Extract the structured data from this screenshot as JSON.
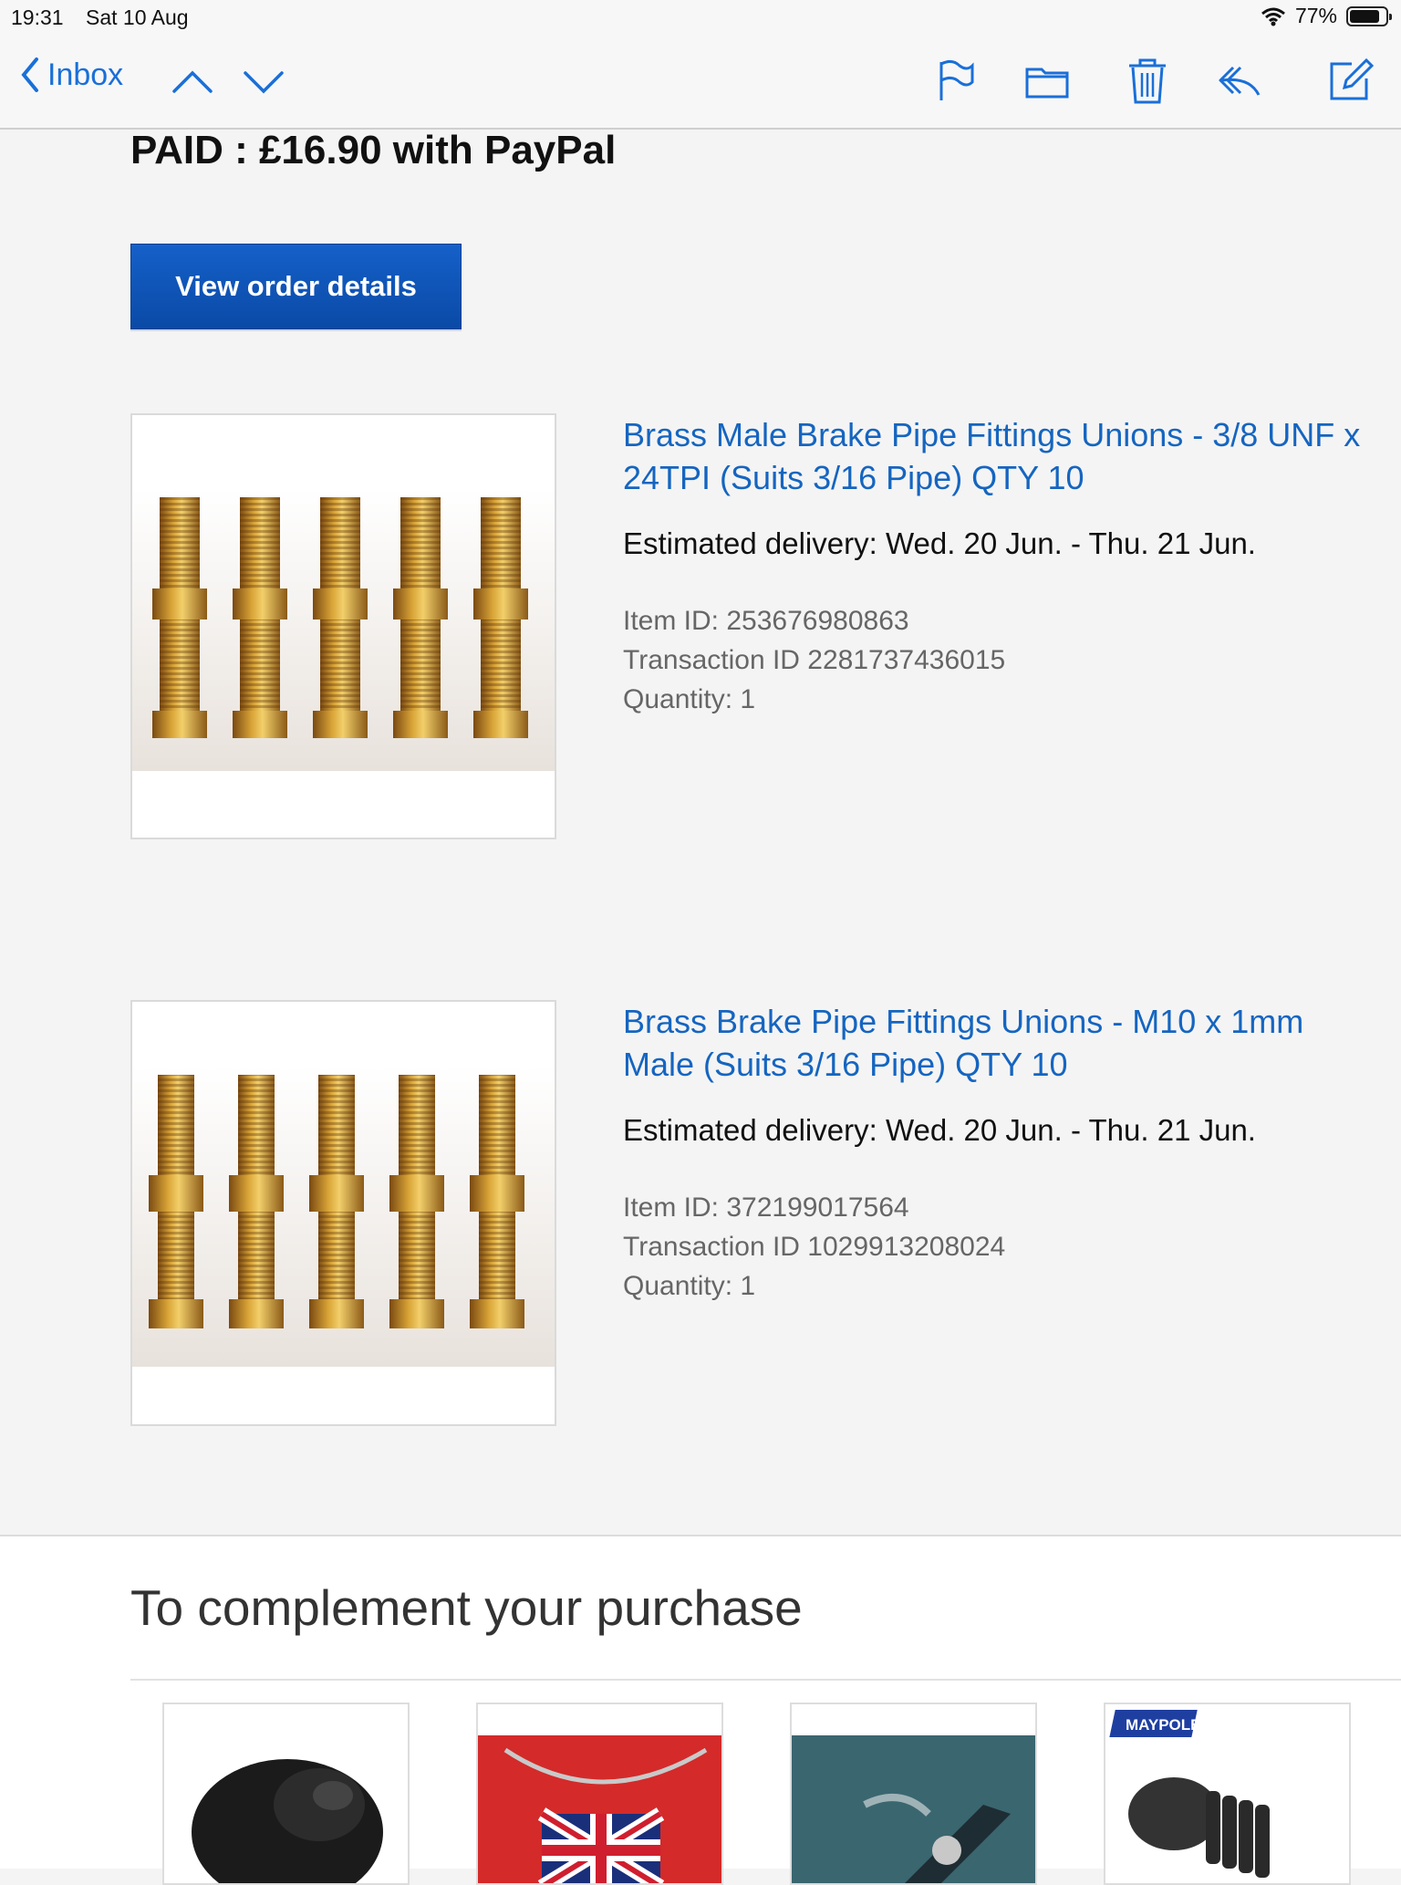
{
  "status_bar": {
    "time": "19:31",
    "date": "Sat 10 Aug",
    "battery": "77%"
  },
  "nav": {
    "back_label": "Inbox"
  },
  "order": {
    "paid_text": "PAID : £16.90 with PayPal",
    "view_button": "View order details"
  },
  "items": [
    {
      "title": "Brass Male Brake Pipe Fittings Unions - 3/8 UNF x 24TPI (Suits 3/16 Pipe) QTY 10",
      "delivery": "Estimated delivery: Wed. 20 Jun. - Thu. 21 Jun.",
      "item_id": "Item ID: 253676980863",
      "transaction_id": "Transaction ID 2281737436015",
      "quantity": "Quantity: 1"
    },
    {
      "title": "Brass Brake Pipe Fittings Unions - M10 x 1mm Male (Suits 3/16 Pipe) QTY 10",
      "delivery": "Estimated delivery: Wed. 20 Jun. - Thu. 21 Jun.",
      "item_id": "Item ID: 372199017564",
      "transaction_id": "Transaction ID 1029913208024",
      "quantity": "Quantity: 1"
    }
  ],
  "complement": {
    "title": "To complement your purchase",
    "logo_text": "MAYPOLE"
  },
  "colors": {
    "link": "#1565c0",
    "button": "#0a55b8",
    "nav_blue": "#1a6fd8"
  }
}
